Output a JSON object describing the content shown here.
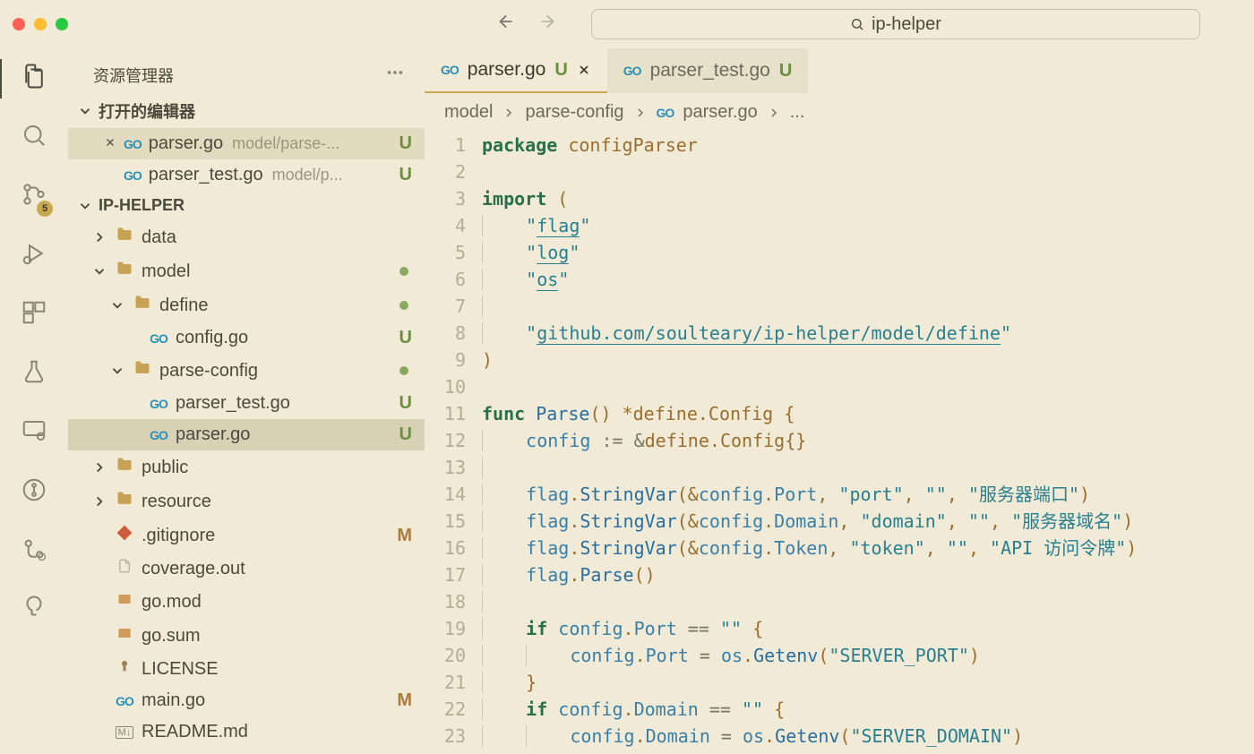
{
  "titlebar": {
    "search_text": "ip-helper"
  },
  "activitybar": {
    "scm_badge": "5"
  },
  "sidebar": {
    "title": "资源管理器",
    "sections": {
      "open_editors_label": "打开的编辑器",
      "project_label": "IP-HELPER"
    },
    "open_editors": [
      {
        "filename": "parser.go",
        "path": "model/parse-...",
        "status": "U",
        "active": true
      },
      {
        "filename": "parser_test.go",
        "path": "model/p...",
        "status": "U",
        "active": false
      }
    ],
    "tree": [
      {
        "kind": "folder",
        "label": "data",
        "indent": 1,
        "open": false
      },
      {
        "kind": "folder",
        "label": "model",
        "indent": 1,
        "open": true,
        "dot": true
      },
      {
        "kind": "folder",
        "label": "define",
        "indent": 2,
        "open": true,
        "dot": true
      },
      {
        "kind": "go",
        "label": "config.go",
        "indent": 3,
        "status": "U"
      },
      {
        "kind": "folder",
        "label": "parse-config",
        "indent": 2,
        "open": true,
        "dot": true
      },
      {
        "kind": "go",
        "label": "parser_test.go",
        "indent": 3,
        "status": "U"
      },
      {
        "kind": "go",
        "label": "parser.go",
        "indent": 3,
        "status": "U",
        "selected": true
      },
      {
        "kind": "folder-special",
        "label": "public",
        "indent": 1,
        "open": false
      },
      {
        "kind": "folder",
        "label": "resource",
        "indent": 1,
        "open": false
      },
      {
        "kind": "git",
        "label": ".gitignore",
        "indent": 1,
        "status": "M"
      },
      {
        "kind": "file",
        "label": "coverage.out",
        "indent": 1
      },
      {
        "kind": "gomod",
        "label": "go.mod",
        "indent": 1
      },
      {
        "kind": "gomod",
        "label": "go.sum",
        "indent": 1
      },
      {
        "kind": "license",
        "label": "LICENSE",
        "indent": 1
      },
      {
        "kind": "go",
        "label": "main.go",
        "indent": 1,
        "status": "M"
      },
      {
        "kind": "md",
        "label": "README.md",
        "indent": 1
      }
    ]
  },
  "tabs": [
    {
      "filename": "parser.go",
      "status": "U",
      "active": true,
      "go": true
    },
    {
      "filename": "parser_test.go",
      "status": "U",
      "active": false,
      "go": true
    }
  ],
  "breadcrumbs": {
    "seg1": "model",
    "seg2": "parse-config",
    "seg3": "parser.go",
    "seg4": "..."
  },
  "code": {
    "lines": [
      {
        "n": 1,
        "tokens": [
          [
            "keyword",
            "package "
          ],
          [
            "pkg",
            "configParser"
          ]
        ]
      },
      {
        "n": 2,
        "tokens": []
      },
      {
        "n": 3,
        "tokens": [
          [
            "keyword",
            "import "
          ],
          [
            "punc",
            "("
          ]
        ]
      },
      {
        "n": 4,
        "indent": 1,
        "tokens": [
          [
            "string",
            "\""
          ],
          [
            "string-u",
            "flag"
          ],
          [
            "string",
            "\""
          ]
        ]
      },
      {
        "n": 5,
        "indent": 1,
        "tokens": [
          [
            "string",
            "\""
          ],
          [
            "string-u",
            "log"
          ],
          [
            "string",
            "\""
          ]
        ]
      },
      {
        "n": 6,
        "indent": 1,
        "tokens": [
          [
            "string",
            "\""
          ],
          [
            "string-u",
            "os"
          ],
          [
            "string",
            "\""
          ]
        ]
      },
      {
        "n": 7,
        "indent": 1,
        "tokens": []
      },
      {
        "n": 8,
        "indent": 1,
        "tokens": [
          [
            "string",
            "\""
          ],
          [
            "string-u",
            "github.com/soulteary/ip-helper/model/define"
          ],
          [
            "string",
            "\""
          ]
        ]
      },
      {
        "n": 9,
        "tokens": [
          [
            "punc",
            ")"
          ]
        ]
      },
      {
        "n": 10,
        "tokens": []
      },
      {
        "n": 11,
        "tokens": [
          [
            "keyword",
            "func "
          ],
          [
            "func",
            "Parse"
          ],
          [
            "punc",
            "() *"
          ],
          [
            "type",
            "define"
          ],
          [
            "punc",
            "."
          ],
          [
            "type",
            "Config"
          ],
          [
            "punc",
            " {"
          ]
        ]
      },
      {
        "n": 12,
        "indent": 1,
        "tokens": [
          [
            "ident",
            "config"
          ],
          [
            "op",
            " := &"
          ],
          [
            "type",
            "define"
          ],
          [
            "punc",
            "."
          ],
          [
            "type",
            "Config"
          ],
          [
            "punc",
            "{}"
          ]
        ]
      },
      {
        "n": 13,
        "indent": 1,
        "tokens": []
      },
      {
        "n": 14,
        "indent": 1,
        "tokens": [
          [
            "ident",
            "flag"
          ],
          [
            "punc",
            "."
          ],
          [
            "func",
            "StringVar"
          ],
          [
            "punc",
            "(&"
          ],
          [
            "ident",
            "config"
          ],
          [
            "punc",
            "."
          ],
          [
            "ident",
            "Port"
          ],
          [
            "punc",
            ", "
          ],
          [
            "string",
            "\"port\""
          ],
          [
            "punc",
            ", "
          ],
          [
            "string",
            "\"\""
          ],
          [
            "punc",
            ", "
          ],
          [
            "string",
            "\"服务器端口\""
          ],
          [
            "punc",
            ")"
          ]
        ]
      },
      {
        "n": 15,
        "indent": 1,
        "tokens": [
          [
            "ident",
            "flag"
          ],
          [
            "punc",
            "."
          ],
          [
            "func",
            "StringVar"
          ],
          [
            "punc",
            "(&"
          ],
          [
            "ident",
            "config"
          ],
          [
            "punc",
            "."
          ],
          [
            "ident",
            "Domain"
          ],
          [
            "punc",
            ", "
          ],
          [
            "string",
            "\"domain\""
          ],
          [
            "punc",
            ", "
          ],
          [
            "string",
            "\"\""
          ],
          [
            "punc",
            ", "
          ],
          [
            "string",
            "\"服务器域名\""
          ],
          [
            "punc",
            ")"
          ]
        ]
      },
      {
        "n": 16,
        "indent": 1,
        "tokens": [
          [
            "ident",
            "flag"
          ],
          [
            "punc",
            "."
          ],
          [
            "func",
            "StringVar"
          ],
          [
            "punc",
            "(&"
          ],
          [
            "ident",
            "config"
          ],
          [
            "punc",
            "."
          ],
          [
            "ident",
            "Token"
          ],
          [
            "punc",
            ", "
          ],
          [
            "string",
            "\"token\""
          ],
          [
            "punc",
            ", "
          ],
          [
            "string",
            "\"\""
          ],
          [
            "punc",
            ", "
          ],
          [
            "string",
            "\"API 访问令牌\""
          ],
          [
            "punc",
            ")"
          ]
        ]
      },
      {
        "n": 17,
        "indent": 1,
        "tokens": [
          [
            "ident",
            "flag"
          ],
          [
            "punc",
            "."
          ],
          [
            "func",
            "Parse"
          ],
          [
            "punc",
            "()"
          ]
        ]
      },
      {
        "n": 18,
        "indent": 1,
        "tokens": []
      },
      {
        "n": 19,
        "indent": 1,
        "tokens": [
          [
            "keyword",
            "if "
          ],
          [
            "ident",
            "config"
          ],
          [
            "punc",
            "."
          ],
          [
            "ident",
            "Port"
          ],
          [
            "op",
            " == "
          ],
          [
            "string",
            "\"\""
          ],
          [
            "punc",
            " {"
          ]
        ]
      },
      {
        "n": 20,
        "indent": 2,
        "tokens": [
          [
            "ident",
            "config"
          ],
          [
            "punc",
            "."
          ],
          [
            "ident",
            "Port"
          ],
          [
            "op",
            " = "
          ],
          [
            "ident",
            "os"
          ],
          [
            "punc",
            "."
          ],
          [
            "func",
            "Getenv"
          ],
          [
            "punc",
            "("
          ],
          [
            "string",
            "\"SERVER_PORT\""
          ],
          [
            "punc",
            ")"
          ]
        ]
      },
      {
        "n": 21,
        "indent": 1,
        "tokens": [
          [
            "punc",
            "}"
          ]
        ]
      },
      {
        "n": 22,
        "indent": 1,
        "tokens": [
          [
            "keyword",
            "if "
          ],
          [
            "ident",
            "config"
          ],
          [
            "punc",
            "."
          ],
          [
            "ident",
            "Domain"
          ],
          [
            "op",
            " == "
          ],
          [
            "string",
            "\"\""
          ],
          [
            "punc",
            " {"
          ]
        ]
      },
      {
        "n": 23,
        "indent": 2,
        "tokens": [
          [
            "ident",
            "config"
          ],
          [
            "punc",
            "."
          ],
          [
            "ident",
            "Domain"
          ],
          [
            "op",
            " = "
          ],
          [
            "ident",
            "os"
          ],
          [
            "punc",
            "."
          ],
          [
            "func",
            "Getenv"
          ],
          [
            "punc",
            "("
          ],
          [
            "string",
            "\"SERVER_DOMAIN\""
          ],
          [
            "punc",
            ")"
          ]
        ]
      }
    ]
  }
}
